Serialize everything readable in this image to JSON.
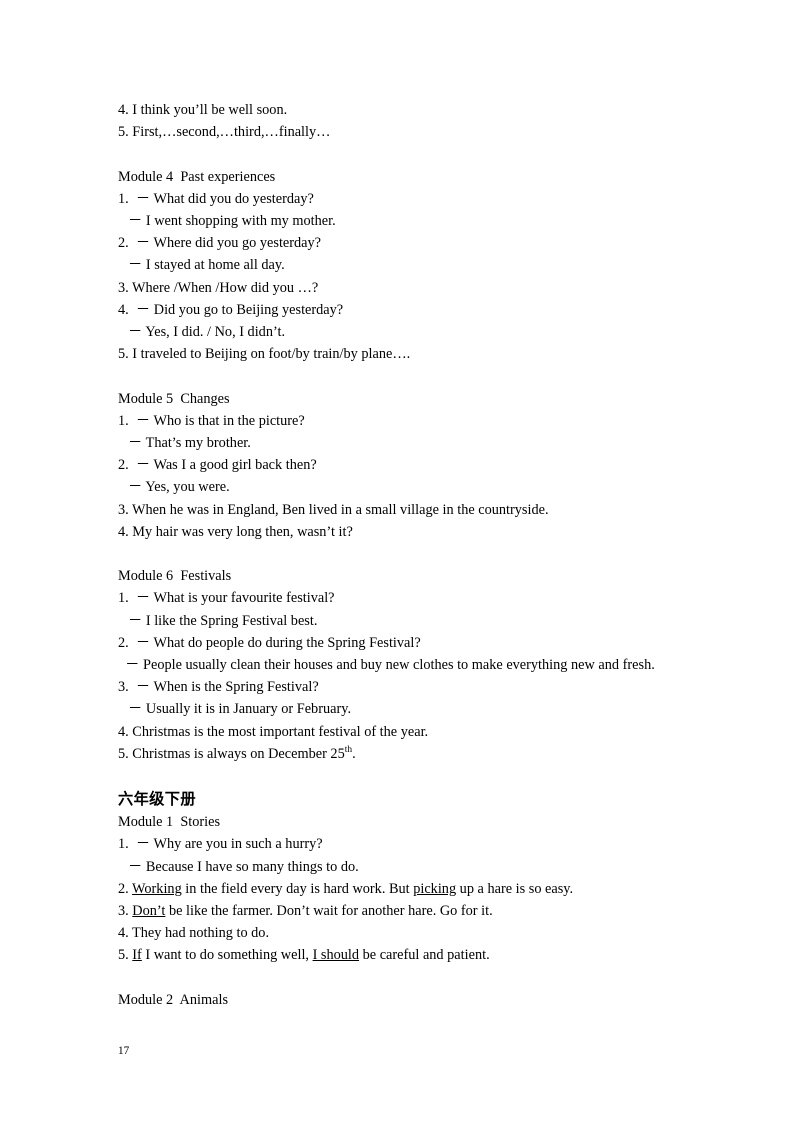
{
  "document": {
    "page_number": "17",
    "blocks": [
      {
        "kind": "line",
        "indent": false,
        "text": "4. I think you’ll be well soon."
      },
      {
        "kind": "line",
        "indent": false,
        "text": "5. First,…second,…third,…finally…"
      },
      {
        "kind": "blank",
        "text": ""
      },
      {
        "kind": "heading",
        "indent": false,
        "text": "Module 4  Past experiences"
      },
      {
        "kind": "line",
        "indent": false,
        "text": "1.  － What did you do yesterday?"
      },
      {
        "kind": "line",
        "indent": true,
        "text": "－ I went shopping with my mother."
      },
      {
        "kind": "line",
        "indent": false,
        "text": "2.  － Where did you go yesterday?"
      },
      {
        "kind": "line",
        "indent": true,
        "text": "－ I stayed at home all day."
      },
      {
        "kind": "line",
        "indent": false,
        "text": "3. Where /When /How did you …?"
      },
      {
        "kind": "line",
        "indent": false,
        "text": "4.  － Did you go to Beijing yesterday?"
      },
      {
        "kind": "line",
        "indent": true,
        "text": "－ Yes, I did. / No, I didn’t."
      },
      {
        "kind": "line",
        "indent": false,
        "text": "5. I traveled to Beijing on foot/by train/by plane…."
      },
      {
        "kind": "blank",
        "text": ""
      },
      {
        "kind": "heading",
        "indent": false,
        "text": "Module 5  Changes"
      },
      {
        "kind": "line",
        "indent": false,
        "text": "1.  － Who is that in the picture?"
      },
      {
        "kind": "line",
        "indent": true,
        "text": "－ That’s my brother."
      },
      {
        "kind": "line",
        "indent": false,
        "text": "2.  － Was I a good girl back then?"
      },
      {
        "kind": "line",
        "indent": true,
        "text": "－ Yes, you were."
      },
      {
        "kind": "line",
        "indent": false,
        "text": "3. When he was in England, Ben lived in a small village in the countryside."
      },
      {
        "kind": "line",
        "indent": false,
        "text": "4. My hair was very long then, wasn’t it?"
      },
      {
        "kind": "blank",
        "text": ""
      },
      {
        "kind": "heading",
        "indent": false,
        "text": "Module 6  Festivals"
      },
      {
        "kind": "line",
        "indent": false,
        "text": "1.  － What is your favourite festival?"
      },
      {
        "kind": "line",
        "indent": true,
        "text": "－ I like the Spring Festival best."
      },
      {
        "kind": "line",
        "indent": false,
        "text": "2.  － What do people do during the Spring Festival?"
      },
      {
        "kind": "justify",
        "indent": false,
        "text": "  － People usually clean their houses and buy new clothes to make everything new and fresh."
      },
      {
        "kind": "line",
        "indent": false,
        "text": "3.  － When is the Spring Festival?"
      },
      {
        "kind": "line",
        "indent": true,
        "text": "－ Usually it is in January or February."
      },
      {
        "kind": "line",
        "indent": false,
        "text": "4. Christmas is the most important festival of the year."
      },
      {
        "kind": "superscript-line",
        "indent": false,
        "before": "5. Christmas is always on December 25",
        "sup": "th",
        "after": "."
      },
      {
        "kind": "blank",
        "text": ""
      },
      {
        "kind": "cn-heading",
        "indent": false,
        "text": "六年级下册"
      },
      {
        "kind": "heading",
        "indent": false,
        "text": "Module 1  Stories"
      },
      {
        "kind": "line",
        "indent": false,
        "text": "1.  － Why are you in such a hurry?"
      },
      {
        "kind": "line",
        "indent": true,
        "text": "－ Because I have so many things to do."
      },
      {
        "kind": "underline-line",
        "indent": false,
        "parts": [
          {
            "t": "2. ",
            "u": false
          },
          {
            "t": "Working",
            "u": true
          },
          {
            "t": " in the field every day is hard work. But ",
            "u": false
          },
          {
            "t": "picking",
            "u": true
          },
          {
            "t": " up a hare is so easy.",
            "u": false
          }
        ]
      },
      {
        "kind": "underline-line",
        "indent": false,
        "parts": [
          {
            "t": "3. ",
            "u": false
          },
          {
            "t": "Don’t",
            "u": true
          },
          {
            "t": " be like the farmer. Don’t wait for another hare. Go for it.",
            "u": false
          }
        ]
      },
      {
        "kind": "line",
        "indent": false,
        "text": "4. They had nothing to do."
      },
      {
        "kind": "underline-line",
        "indent": false,
        "parts": [
          {
            "t": "5. ",
            "u": false
          },
          {
            "t": "If",
            "u": true
          },
          {
            "t": " I want to do something well, ",
            "u": false
          },
          {
            "t": "I should",
            "u": true
          },
          {
            "t": " be careful and patient.",
            "u": false
          }
        ]
      },
      {
        "kind": "blank",
        "text": ""
      },
      {
        "kind": "heading",
        "indent": false,
        "text": "Module 2  Animals"
      }
    ]
  }
}
